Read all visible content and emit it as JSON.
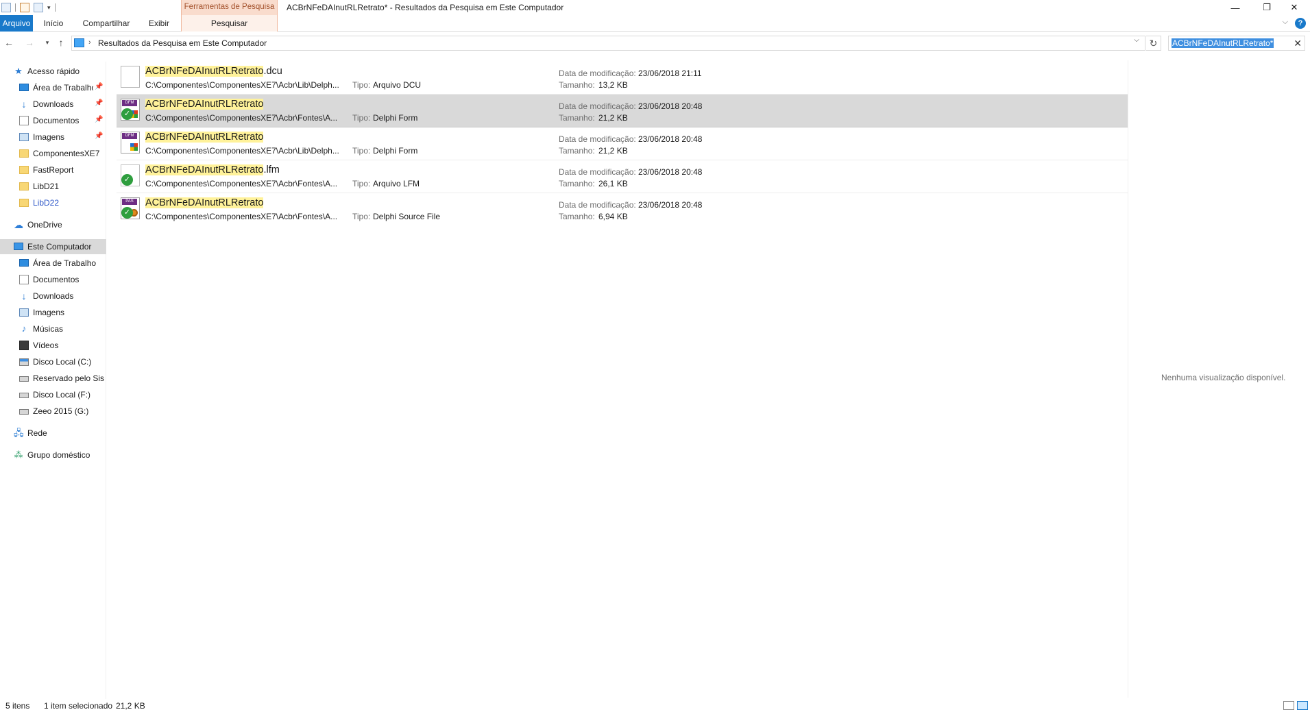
{
  "window": {
    "title": "ACBrNFeDAInutRLRetrato* - Resultados da Pesquisa em Este Computador",
    "context_tab_header": "Ferramentas de Pesquisa",
    "controls": {
      "minimize": "—",
      "restore": "❐",
      "close": "✕"
    }
  },
  "ribbon": {
    "tabs": [
      {
        "label": "Arquivo",
        "active": true
      },
      {
        "label": "Início"
      },
      {
        "label": "Compartilhar"
      },
      {
        "label": "Exibir"
      },
      {
        "label": "Pesquisar",
        "contextual": true
      }
    ],
    "help": "?"
  },
  "address": {
    "path": "Resultados da Pesquisa em Este Computador",
    "search_value": "ACBrNFeDAInutRLRetrato*"
  },
  "navpane": {
    "quick_access": {
      "label": "Acesso rápido",
      "items": [
        {
          "label": "Área de Trabalho",
          "icon": "desktop-icon",
          "pinned": true
        },
        {
          "label": "Downloads",
          "icon": "downloads-icon",
          "pinned": true
        },
        {
          "label": "Documentos",
          "icon": "documents-icon",
          "pinned": true
        },
        {
          "label": "Imagens",
          "icon": "pictures-icon",
          "pinned": true
        },
        {
          "label": "ComponentesXE7",
          "icon": "folder-icon"
        },
        {
          "label": "FastReport",
          "icon": "folder-icon"
        },
        {
          "label": "LibD21",
          "icon": "folder-icon"
        },
        {
          "label": "LibD22",
          "icon": "folder-icon"
        }
      ]
    },
    "onedrive": "OneDrive",
    "this_pc": {
      "label": "Este Computador",
      "items": [
        {
          "label": "Área de Trabalho",
          "icon": "desktop-icon"
        },
        {
          "label": "Documentos",
          "icon": "documents-icon"
        },
        {
          "label": "Downloads",
          "icon": "downloads-icon"
        },
        {
          "label": "Imagens",
          "icon": "pictures-icon"
        },
        {
          "label": "Músicas",
          "icon": "music-icon"
        },
        {
          "label": "Vídeos",
          "icon": "videos-icon"
        },
        {
          "label": "Disco Local (C:)",
          "icon": "drive-c-icon"
        },
        {
          "label": "Reservado pelo Sistema",
          "icon": "drive-icon"
        },
        {
          "label": "Disco Local (F:)",
          "icon": "drive-icon"
        },
        {
          "label": "Zeeo 2015 (G:)",
          "icon": "drive-icon"
        }
      ]
    },
    "network": "Rede",
    "homegroup": "Grupo doméstico"
  },
  "results": {
    "labels": {
      "type": "Tipo:",
      "date": "Data de modificação:",
      "size": "Tamanho:"
    },
    "items": [
      {
        "name_match": "ACBrNFeDAInutRLRetrato",
        "name_rest": ".dcu",
        "path": "C:\\Componentes\\ComponentesXE7\\Acbr\\Lib\\Delph...",
        "type": "Arquivo DCU",
        "date": "23/06/2018 21:11",
        "size": "13,2 KB",
        "icon": "dcu-file-icon",
        "selected": false
      },
      {
        "name_match": "ACBrNFeDAInutRLRetrato",
        "name_rest": "",
        "path": "C:\\Componentes\\ComponentesXE7\\Acbr\\Fontes\\A...",
        "type": "Delphi Form",
        "date": "23/06/2018 20:48",
        "size": "21,2 KB",
        "icon": "dfm-file-icon",
        "selected": true
      },
      {
        "name_match": "ACBrNFeDAInutRLRetrato",
        "name_rest": "",
        "path": "C:\\Componentes\\ComponentesXE7\\Acbr\\Lib\\Delph...",
        "type": "Delphi Form",
        "date": "23/06/2018 20:48",
        "size": "21,2 KB",
        "icon": "dfm-file-icon",
        "selected": false
      },
      {
        "name_match": "ACBrNFeDAInutRLRetrato",
        "name_rest": ".lfm",
        "path": "C:\\Componentes\\ComponentesXE7\\Acbr\\Fontes\\A...",
        "type": "Arquivo LFM",
        "date": "23/06/2018 20:48",
        "size": "26,1 KB",
        "icon": "lfm-file-icon",
        "selected": false
      },
      {
        "name_match": "ACBrNFeDAInutRLRetrato",
        "name_rest": "",
        "path": "C:\\Componentes\\ComponentesXE7\\Acbr\\Fontes\\A...",
        "type": "Delphi Source File",
        "date": "23/06/2018 20:48",
        "size": "6,94 KB",
        "icon": "pas-file-icon",
        "selected": false
      }
    ]
  },
  "preview": {
    "message": "Nenhuma visualização disponível."
  },
  "status": {
    "count": "5 itens",
    "selection": "1 item selecionado",
    "selection_size": "21,2 KB"
  }
}
